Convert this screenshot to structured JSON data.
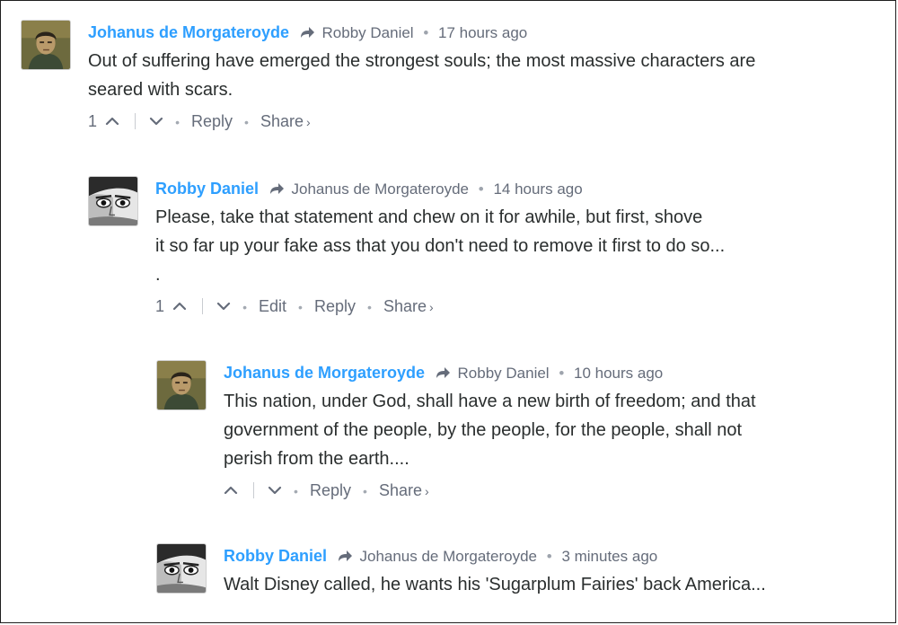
{
  "comments": [
    {
      "author": "Johanus de Morgateroyde",
      "reply_to": "Robby Daniel",
      "time": "17 hours ago",
      "text_lines": [
        "Out of suffering have emerged the strongest souls; the most massive characters are",
        "seared with scars."
      ],
      "upvotes": "1",
      "actions": {
        "reply": "Reply",
        "share": "Share",
        "share_caret": "›"
      }
    },
    {
      "author": "Robby Daniel",
      "reply_to": "Johanus de Morgateroyde",
      "time": "14 hours ago",
      "text_lines": [
        "Please, take that statement and chew on it for awhile, but first, shove",
        "it so far up your fake ass that you don't need to remove it first to do so...",
        "."
      ],
      "upvotes": "1",
      "actions": {
        "edit": "Edit",
        "reply": "Reply",
        "share": "Share",
        "share_caret": "›"
      }
    },
    {
      "author": "Johanus de Morgateroyde",
      "reply_to": "Robby Daniel",
      "time": "10 hours ago",
      "text_lines": [
        "This nation, under God, shall have a new birth of freedom; and that",
        "government of the people, by the people, for the people, shall not",
        "perish from the earth...."
      ],
      "upvotes": "",
      "actions": {
        "reply": "Reply",
        "share": "Share",
        "share_caret": "›"
      }
    },
    {
      "author": "Robby Daniel",
      "reply_to": "Johanus de Morgateroyde",
      "time": "3 minutes ago",
      "text_lines": [
        "Walt Disney called, he wants his 'Sugarplum Fairies' back America..."
      ]
    }
  ],
  "separator": "•",
  "colors": {
    "author": "#2e9fff",
    "meta": "#656c7a",
    "text": "#2a2e2e"
  }
}
